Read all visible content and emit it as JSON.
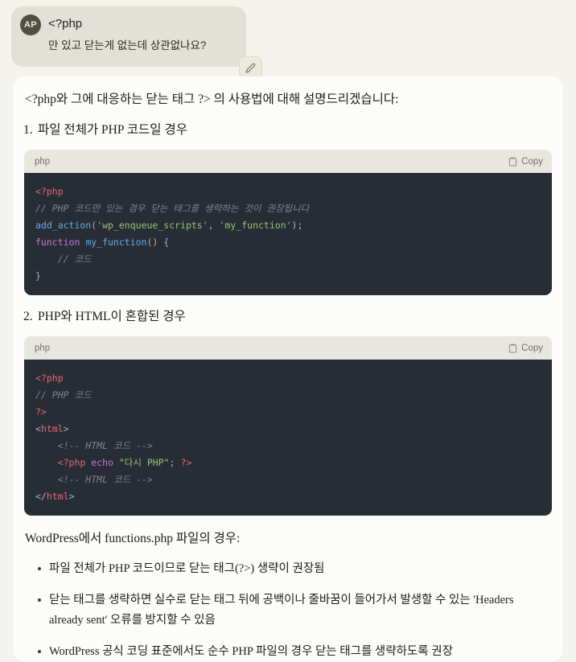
{
  "conversation": {
    "user": {
      "avatar_initials": "AP",
      "line1": "<?php",
      "line2": "만 있고 닫는게 없는데 상관없나요?",
      "edit_icon": "pencil-icon"
    },
    "assistant": {
      "intro": "<?php와 그에 대응하는 닫는 태그 ?> 의 사용법에 대해 설명드리겠습니다:",
      "sections": [
        {
          "number": "1.",
          "heading": "파일 전체가 PHP 코드일 경우",
          "code": {
            "language": "php",
            "copy_label": "Copy",
            "copy_icon": "clipboard-icon",
            "lines": [
              [
                {
                  "t": "<?php",
                  "c": "tag"
                }
              ],
              [
                {
                  "t": "// PHP 코드만 있는 경우 닫는 태그를 생략하는 것이 권장됩니다",
                  "c": "cm"
                }
              ],
              [
                {
                  "t": "add_action",
                  "c": "fn"
                },
                {
                  "t": "(",
                  "c": "punc"
                },
                {
                  "t": "'wp_enqueue_scripts'",
                  "c": "str"
                },
                {
                  "t": ", ",
                  "c": "punc"
                },
                {
                  "t": "'my_function'",
                  "c": "str"
                },
                {
                  "t": ");",
                  "c": "punc"
                }
              ],
              [
                {
                  "t": "function ",
                  "c": "kw"
                },
                {
                  "t": "my_function",
                  "c": "fn"
                },
                {
                  "t": "() {",
                  "c": "punc"
                }
              ],
              [
                {
                  "t": "    // 코드",
                  "c": "cm"
                }
              ],
              [
                {
                  "t": "}",
                  "c": "punc"
                }
              ]
            ]
          }
        },
        {
          "number": "2.",
          "heading": "PHP와 HTML이 혼합된 경우",
          "code": {
            "language": "php",
            "copy_label": "Copy",
            "copy_icon": "clipboard-icon",
            "lines": [
              [
                {
                  "t": "<?php",
                  "c": "tag"
                }
              ],
              [
                {
                  "t": "// PHP 코드",
                  "c": "cm"
                }
              ],
              [
                {
                  "t": "?>",
                  "c": "tag"
                }
              ],
              [
                {
                  "t": "<",
                  "c": "punc"
                },
                {
                  "t": "html",
                  "c": "tag"
                },
                {
                  "t": ">",
                  "c": "punc"
                }
              ],
              [
                {
                  "t": "    <!-- HTML 코드 -->",
                  "c": "cm"
                }
              ],
              [
                {
                  "t": "    <?php ",
                  "c": "tag"
                },
                {
                  "t": "echo ",
                  "c": "kw"
                },
                {
                  "t": "\"다시 PHP\"",
                  "c": "str"
                },
                {
                  "t": "; ",
                  "c": "punc"
                },
                {
                  "t": "?>",
                  "c": "tag"
                }
              ],
              [
                {
                  "t": "    <!-- HTML 코드 -->",
                  "c": "cm"
                }
              ],
              [
                {
                  "t": "</",
                  "c": "punc"
                },
                {
                  "t": "html",
                  "c": "tag"
                },
                {
                  "t": ">",
                  "c": "punc"
                }
              ]
            ]
          }
        }
      ],
      "outro": "WordPress에서 functions.php 파일의 경우:",
      "bullets": [
        "파일 전체가 PHP 코드이므로 닫는 태그(?>) 생략이 권장됨",
        "닫는 태그를 생략하면 실수로 닫는 태그 뒤에 공백이나 줄바꿈이 들어가서 발생할 수 있는 'Headers already sent' 오류를 방지할 수 있음",
        "WordPress 공식 코딩 표준에서도 순수 PHP 파일의 경우 닫는 태그를 생략하도록 권장"
      ]
    }
  },
  "colors": {
    "page_background": "#f4f3ed",
    "user_bubble": "#e2e1d7",
    "assistant_background": "#fcfcfa",
    "code_header": "#e8e6de",
    "code_background": "#282c34",
    "syntax_tag": "#e06c75",
    "syntax_comment": "#7f848e",
    "syntax_function": "#61afef",
    "syntax_string": "#98c379",
    "syntax_keyword": "#c678dd",
    "syntax_punctuation": "#abb2bf",
    "avatar_background": "#514f3f"
  }
}
